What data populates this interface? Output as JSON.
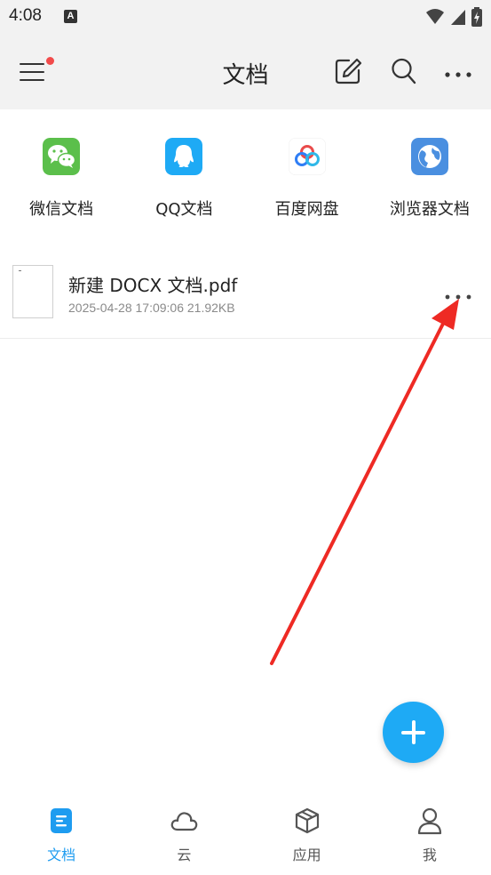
{
  "status_bar": {
    "time": "4:08",
    "notification_glyph": "A"
  },
  "app_bar": {
    "title": "文档"
  },
  "sources": [
    {
      "label": "微信文档",
      "icon": "wechat-icon",
      "color": "#5bbf4b"
    },
    {
      "label": "QQ文档",
      "icon": "qq-icon",
      "color": "#1eaaf5"
    },
    {
      "label": "百度网盘",
      "icon": "baidu-netdisk-icon",
      "color": "#2f7ef5"
    },
    {
      "label": "浏览器文档",
      "icon": "browser-icon",
      "color": "#4a8fe0"
    }
  ],
  "files": [
    {
      "name": "新建 DOCX 文档.pdf",
      "meta": "2025-04-28 17:09:06 21.92KB"
    }
  ],
  "bottom_nav": [
    {
      "label": "文档",
      "icon": "document-icon",
      "active": true
    },
    {
      "label": "云",
      "icon": "cloud-icon",
      "active": false
    },
    {
      "label": "应用",
      "icon": "apps-cube-icon",
      "active": false
    },
    {
      "label": "我",
      "icon": "user-icon",
      "active": false
    }
  ],
  "colors": {
    "accent": "#1eaaf5",
    "active_nav": "#1e9cf0",
    "notification_dot": "#f24b4b",
    "annotation_arrow": "#ee2a24"
  }
}
